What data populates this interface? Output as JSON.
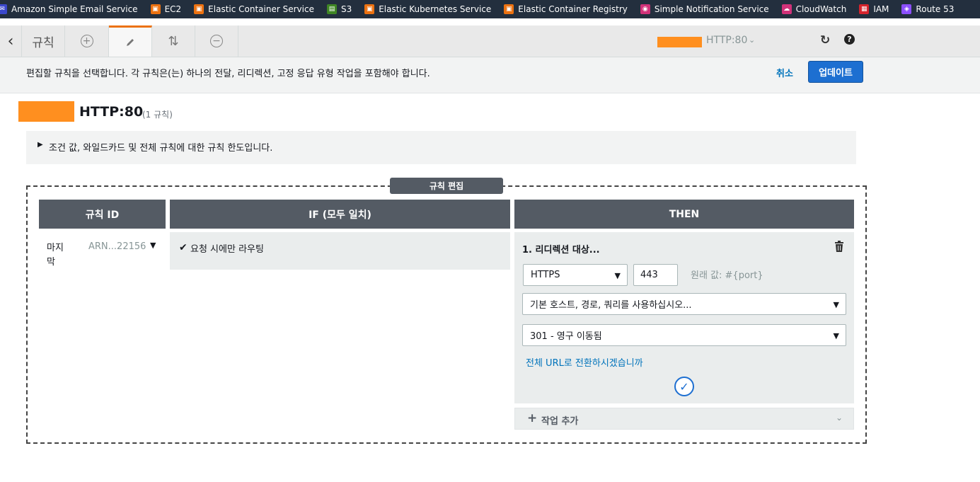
{
  "favorites": [
    {
      "label": "Amazon Simple Email Service",
      "icon": "ses-icon",
      "color": "#3b48cc"
    },
    {
      "label": "EC2",
      "icon": "ec2-icon",
      "color": "#ec7211"
    },
    {
      "label": "Elastic Container Service",
      "icon": "ecs-icon",
      "color": "#ec7211"
    },
    {
      "label": "S3",
      "icon": "s3-icon",
      "color": "#3f8624"
    },
    {
      "label": "Elastic Kubernetes Service",
      "icon": "eks-icon",
      "color": "#ec7211"
    },
    {
      "label": "Elastic Container Registry",
      "icon": "ecr-icon",
      "color": "#ec7211"
    },
    {
      "label": "Simple Notification Service",
      "icon": "sns-icon",
      "color": "#d13279"
    },
    {
      "label": "CloudWatch",
      "icon": "cloudwatch-icon",
      "color": "#d13279"
    },
    {
      "label": "IAM",
      "icon": "iam-icon",
      "color": "#d6242d"
    },
    {
      "label": "Route 53",
      "icon": "route53-icon",
      "color": "#8c4fff"
    }
  ],
  "toolbar": {
    "rules_tab": "규칙",
    "listener": "HTTP:80"
  },
  "info": {
    "message": "편집할 규칙을 선택합니다. 각 규칙은(는) 하나의 전달, 리디렉션, 고정 응답 유형 작업을 포함해야 합니다.",
    "cancel": "취소",
    "update": "업데이트"
  },
  "header": {
    "title": "HTTP:80",
    "count": "(1 규칙)"
  },
  "disclosure": {
    "text": "조건 값, 와일드카드 및 전체 규칙에 대한 규칙 한도입니다."
  },
  "editor": {
    "frame_label": "규칙 편집",
    "col_id": "규칙 ID",
    "col_if": "IF (모두 일치)",
    "col_then": "THEN"
  },
  "rule": {
    "id_label": "마지막",
    "arn": "ARN...22156",
    "condition": "요청 시에만 라우팅"
  },
  "action": {
    "title": "1. 리디렉션 대상...",
    "protocol": "HTTPS",
    "port": "443",
    "original_value": "원래 값: #{port}",
    "host_option": "기본 호스트, 경로, 쿼리를 사용하십시오...",
    "status_code": "301 - 영구 이동됨",
    "full_url_link": "전체 URL로 전환하시겠습니까"
  },
  "add_action": {
    "label": "작업 추가"
  },
  "colors": {
    "accent": "#ec7211",
    "primary_button": "#1d6fd1",
    "link": "#0073bb",
    "header_bg": "#545b64",
    "nav_bg": "#232f3e"
  }
}
